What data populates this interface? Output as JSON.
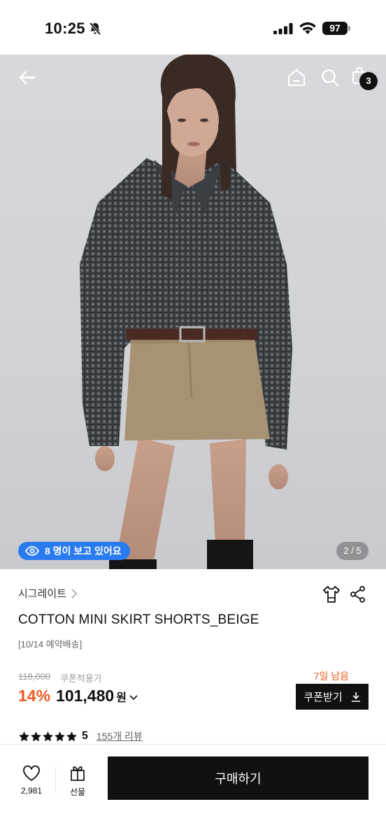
{
  "status_bar": {
    "time": "10:25",
    "battery": "97",
    "icons": [
      "bell-slash-icon",
      "signal-icon",
      "wifi-icon",
      "battery-icon"
    ]
  },
  "header": {
    "icons": [
      "back-arrow-icon",
      "home-icon",
      "search-icon",
      "shopping-bag-icon"
    ],
    "cart_count": "3"
  },
  "gallery": {
    "viewers_text": "8 명이 보고 있어요",
    "page_indicator": "2 / 5"
  },
  "product": {
    "brand": "시그레이트",
    "title": "COTTON MINI SKIRT SHORTS_BEIGE",
    "delivery_note": "[10/14 예약배송]",
    "original_price": "118,000",
    "coupon_note": "쿠폰적용가",
    "discount": "14%",
    "price": "101,480",
    "currency": "원",
    "days_left": "7일 남음",
    "coupon_button": "쿠폰받기",
    "rating": "5",
    "reviews_link": "155개 리뷰",
    "stars": 5
  },
  "bottom_bar": {
    "like_count": "2,981",
    "gift_label": "선물",
    "buy_label": "구매하기"
  },
  "colors": {
    "accent_orange": "#f15a22",
    "pill_blue": "#2a7bf0",
    "black": "#111111"
  }
}
